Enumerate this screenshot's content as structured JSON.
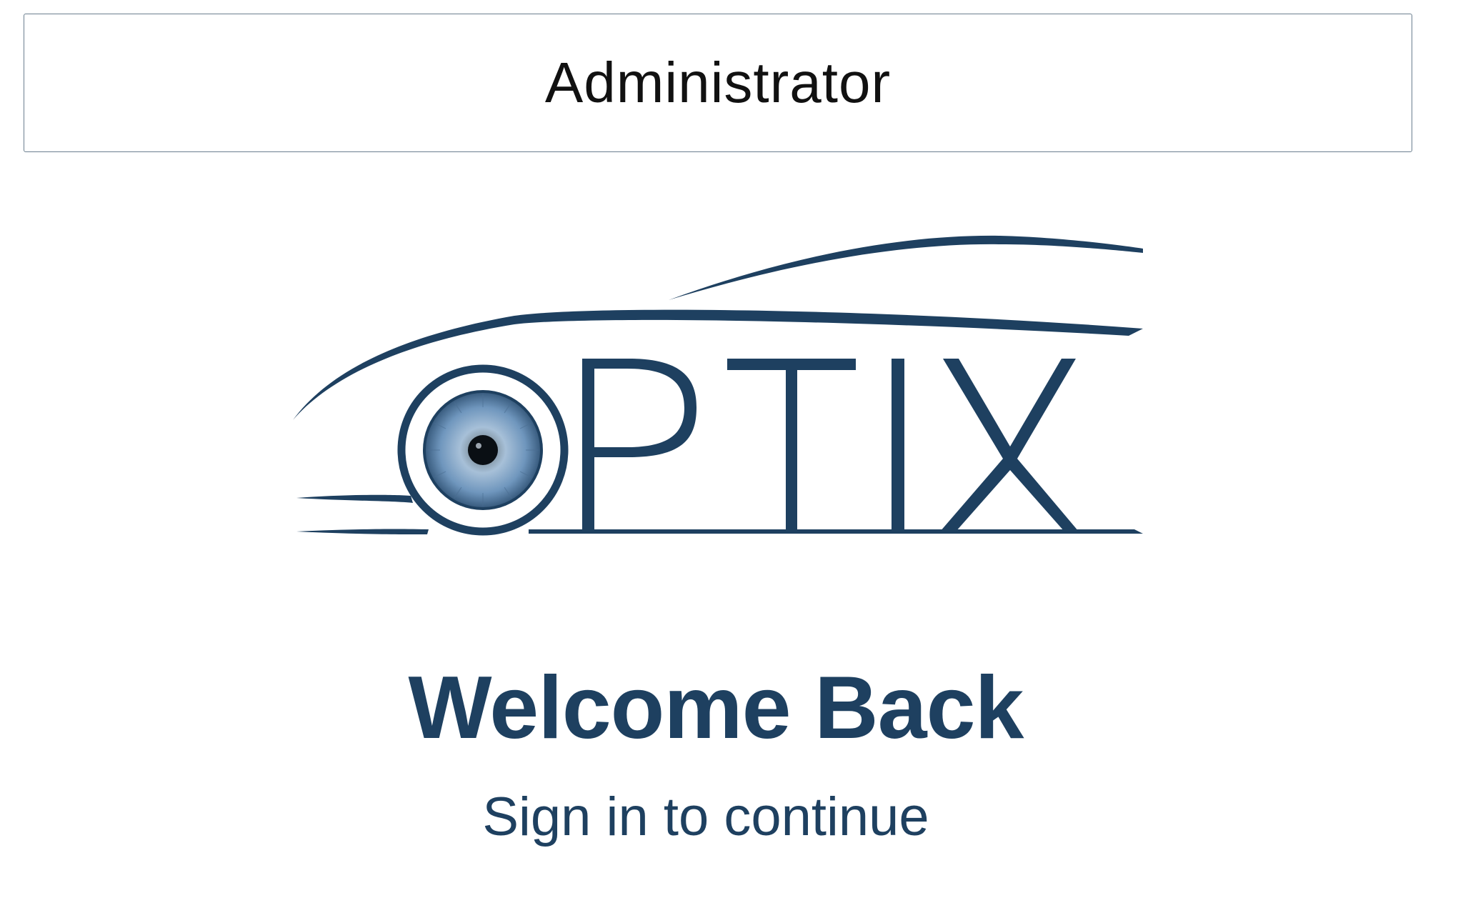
{
  "role_selector": {
    "label": "Administrator"
  },
  "logo": {
    "wordmark": "OPTIX",
    "icon": "eye-icon",
    "brand_color": "#1e4060",
    "iris_color": "#6f96bd"
  },
  "welcome": {
    "title": "Welcome Back",
    "subtitle": "Sign in to continue"
  }
}
